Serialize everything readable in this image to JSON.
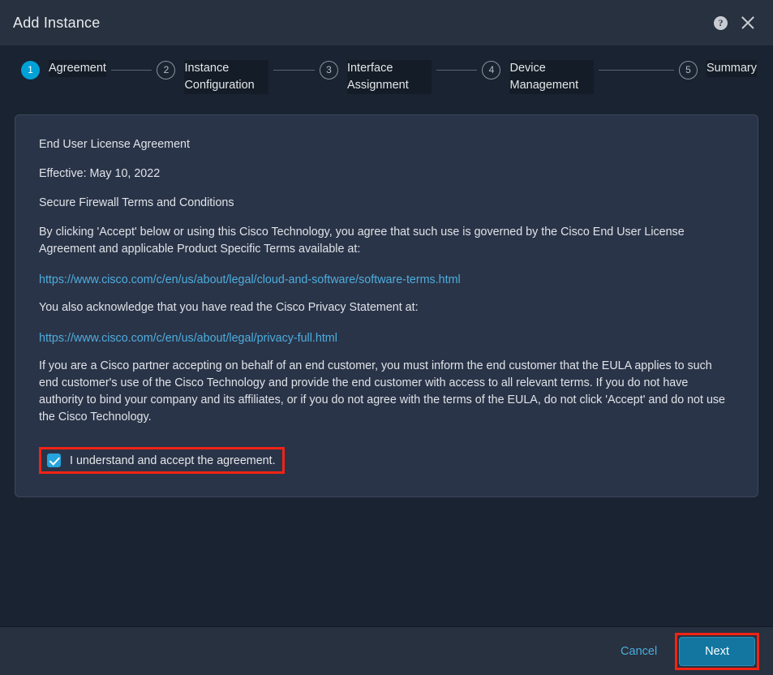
{
  "titlebar": {
    "title": "Add Instance",
    "help_icon": "help-circle-icon",
    "close_icon": "close-icon"
  },
  "stepper": {
    "steps": [
      {
        "number": "1",
        "label": "Agreement",
        "state": "active"
      },
      {
        "number": "2",
        "label": "Instance Configuration",
        "state": "inactive"
      },
      {
        "number": "3",
        "label": "Interface Assignment",
        "state": "inactive"
      },
      {
        "number": "4",
        "label": "Device Management",
        "state": "inactive"
      },
      {
        "number": "5",
        "label": "Summary",
        "state": "inactive"
      }
    ]
  },
  "agreement": {
    "heading": "End User License Agreement",
    "effective": "Effective: May 10, 2022",
    "subheading": "Secure Firewall Terms and Conditions",
    "paragraph_1": "By clicking 'Accept' below or using this Cisco Technology, you agree that such use is governed by the Cisco End User License Agreement and applicable Product Specific Terms available at:",
    "link_1": "https://www.cisco.com/c/en/us/about/legal/cloud-and-software/software-terms.html",
    "paragraph_2": "You also acknowledge that you have read the Cisco Privacy Statement at:",
    "link_2": "https://www.cisco.com/c/en/us/about/legal/privacy-full.html",
    "paragraph_3": "If you are a Cisco partner accepting on behalf of an end customer, you must inform the end customer that the EULA applies to such end customer's use of the Cisco Technology and provide the end customer with access to all relevant terms. If you do not have authority to bind your company and its affiliates, or if you do not agree with the terms of the EULA, do not click 'Accept' and do not use the Cisco Technology.",
    "accept_label": "I understand and accept the agreement.",
    "accept_checked": true
  },
  "footer": {
    "cancel_label": "Cancel",
    "next_label": "Next"
  },
  "colors": {
    "accent": "#00a1d6",
    "link": "#4dadde",
    "highlight": "#f22314",
    "primary_button": "#1276a0",
    "page_background": "#1a2331",
    "card_background": "#2a3448",
    "bar_background": "#27313f"
  }
}
